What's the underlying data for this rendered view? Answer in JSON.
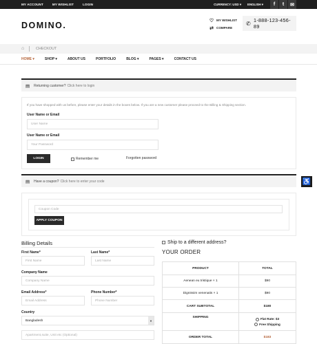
{
  "topbar": {
    "my_account": "MY ACCOUNT",
    "my_wishlist": "MY WISHLIST",
    "login": "LOGIN",
    "currency_label": "CURRENCY: USD",
    "language_label": "ENGLISH",
    "dropdown_glyph": "▾",
    "social": [
      {
        "name": "facebook-icon",
        "glyph": "f"
      },
      {
        "name": "twitter-icon",
        "glyph": "t"
      },
      {
        "name": "email-icon",
        "glyph": "✉"
      }
    ]
  },
  "header": {
    "logo": "DOMINO.",
    "wishlist_label": "MY WISHLIST",
    "compare_label": "COMPARE",
    "phone": "1-888-123-456-89"
  },
  "breadcrumb": {
    "current": "CHECKOUT"
  },
  "nav": {
    "items": [
      {
        "label": "HOME ▾"
      },
      {
        "label": "SHOP ▾"
      },
      {
        "label": "ABOUT US"
      },
      {
        "label": "PORTFOLIO"
      },
      {
        "label": "BLOG ▾"
      },
      {
        "label": "PAGES ▾"
      },
      {
        "label": "CONTACT US"
      }
    ]
  },
  "login_notice": {
    "text": "Returning customer?",
    "link": "Click here to login"
  },
  "login_form": {
    "intro": "If you have shopped with us before, please enter your details in the boxes below. If you are a new customer please proceed to the Billing & Shipping section.",
    "username_label": "User Name or Email",
    "username_placeholder": "User Name",
    "password_label": "User Name or Email",
    "password_placeholder": "Your Password",
    "login_button": "LOGIN",
    "remember_label": "Remember me",
    "forgot_link": "Forgotten password"
  },
  "coupon_notice": {
    "text": "Have a coupon?",
    "link": "Click here to enter your code"
  },
  "coupon_form": {
    "placeholder": "Coupon Code",
    "apply_button": "APPLY COUPON"
  },
  "billing": {
    "title": "Billing Details",
    "first_name_label": "First Name*",
    "first_name_placeholder": "First Name",
    "last_name_label": "Last Name*",
    "last_name_placeholder": "Last Name",
    "company_label": "Company Name",
    "company_placeholder": "Company Name",
    "email_label": "Email Address*",
    "email_placeholder": "Email Address",
    "phone_label": "Phone Number*",
    "phone_placeholder": "Phone Number",
    "country_label": "Country",
    "country_value": "Bangladesh",
    "address_placeholder": "Apartment,suite, Unit etc (Optional)"
  },
  "shipping": {
    "ship_label": "Ship to a different address?"
  },
  "order": {
    "title": "YOUR ORDER",
    "col_product": "PRODUCT",
    "col_total": "TOTAL",
    "items": [
      {
        "name": "Aenean eu tristique × 1",
        "total": "$90"
      },
      {
        "name": "Dignissim venenatis × 1",
        "total": "$90"
      }
    ],
    "subtotal_label": "CART SUBTOTAL",
    "subtotal_value": "$180",
    "shipping_label": "SHIPPING",
    "flat_rate": "Flat Rate: $3",
    "free_shipping": "Free Shipping",
    "total_label": "ORDER TOTAL",
    "total_value": "$183",
    "total_color": "#b5643a"
  }
}
